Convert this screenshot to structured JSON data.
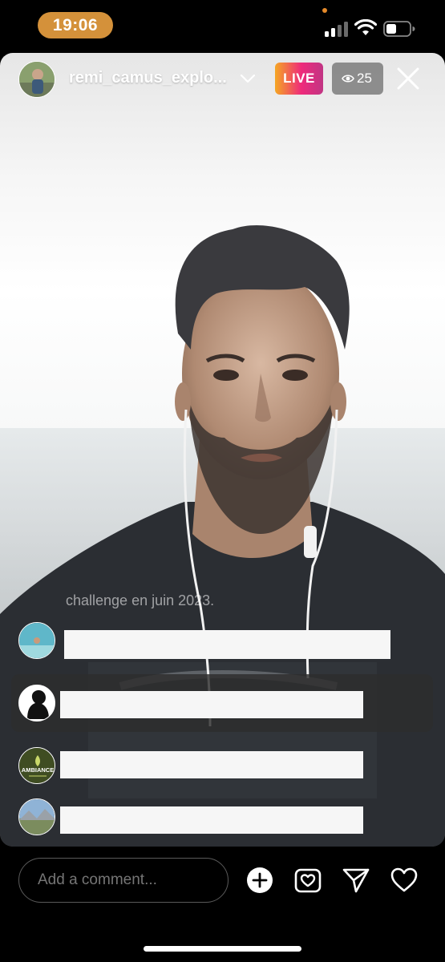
{
  "status_bar": {
    "time": "19:06",
    "icons": [
      "cellular-signal-icon",
      "wifi-icon",
      "battery-icon"
    ],
    "accent_color": "#d4913a"
  },
  "live": {
    "host_username": "remi_camus_explo...",
    "live_label": "LIVE",
    "viewer_count": "25",
    "icons": [
      "chevron-down-icon",
      "eye-icon",
      "close-icon"
    ]
  },
  "comments": {
    "faded_text": "challenge en juin 2023.",
    "avatars": [
      {
        "name": "comment-avatar-beach"
      },
      {
        "name": "comment-avatar-silhouette"
      },
      {
        "name": "comment-avatar-ambiance",
        "logo_text": "AMBIANCE"
      },
      {
        "name": "comment-avatar-landscape"
      }
    ]
  },
  "composer": {
    "placeholder": "Add a comment...",
    "actions": [
      "add-icon",
      "shopping-bag-icon",
      "send-icon",
      "heart-icon"
    ]
  },
  "colors": {
    "live_gradient_start": "#f5a623",
    "live_gradient_end": "#c13584",
    "background": "#000000"
  }
}
